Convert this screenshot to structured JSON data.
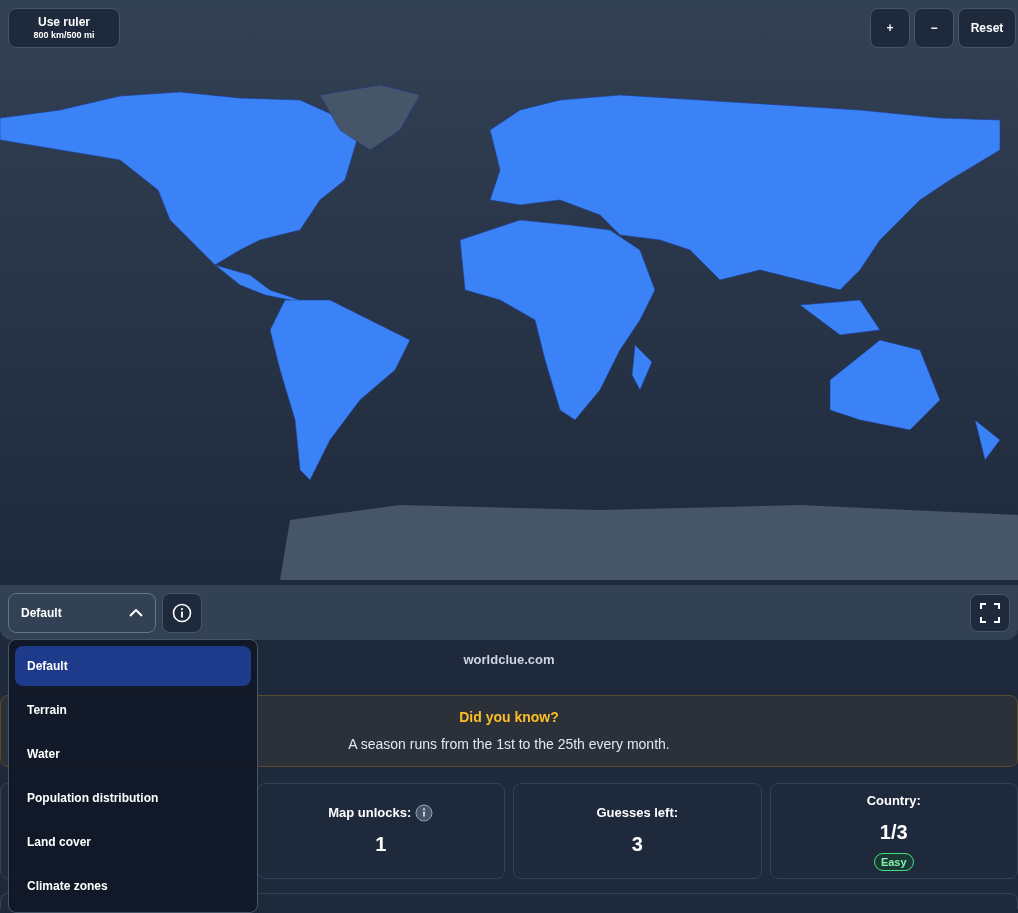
{
  "ruler_button": {
    "label": "Use ruler",
    "scale": "800 km/500 mi"
  },
  "zoom_controls": [
    {
      "label": "+"
    },
    {
      "label": "−"
    },
    {
      "label": "Reset"
    }
  ],
  "layer_select": {
    "value": "Default",
    "expanded": true
  },
  "layer_options": [
    {
      "label": "Default",
      "selected": true
    },
    {
      "label": "Terrain",
      "selected": false
    },
    {
      "label": "Water",
      "selected": false
    },
    {
      "label": "Population distribution",
      "selected": false
    },
    {
      "label": "Land cover",
      "selected": false
    },
    {
      "label": "Climate zones",
      "selected": false
    }
  ],
  "site": "worldclue.com",
  "fact": {
    "title": "Did you know?",
    "text": "A season runs from the 1st to the 25th every month."
  },
  "stats": [
    {
      "kind": "covered"
    },
    {
      "kind": "info",
      "label": "Map unlocks:",
      "value": "1"
    },
    {
      "kind": "plain",
      "label": "Guesses left:",
      "value": "3"
    },
    {
      "kind": "badge",
      "label": "Country:",
      "value": "1/3",
      "badge": "Easy"
    }
  ]
}
